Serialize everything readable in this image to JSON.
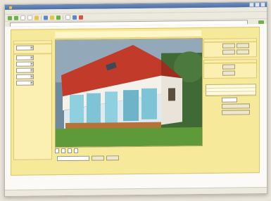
{
  "browser": {
    "title": "",
    "menu": [
      "",
      "",
      "",
      "",
      "",
      ""
    ],
    "address": ""
  },
  "app": {
    "header": "",
    "left": {
      "sections": [
        "",
        ""
      ],
      "fields": [
        {
          "label": "",
          "value": ""
        },
        {
          "label": "",
          "value": ""
        },
        {
          "label": "",
          "value": ""
        },
        {
          "label": "",
          "value": ""
        },
        {
          "label": "",
          "value": ""
        },
        {
          "label": "",
          "value": ""
        }
      ]
    },
    "right": {
      "section1": "",
      "rows1": [
        {
          "label": "",
          "b1": "",
          "b2": ""
        },
        {
          "label": "",
          "b1": "",
          "b2": ""
        }
      ],
      "section2": "",
      "rows2": [
        {
          "label": "",
          "b1": ""
        },
        {
          "label": "",
          "b1": ""
        }
      ],
      "big_heading": "",
      "table_rows": [
        "",
        "",
        ""
      ],
      "row_select": {
        "label": "",
        "value": ""
      },
      "buttons": [
        "",
        ""
      ]
    },
    "caption_chips": [
      "",
      "",
      "",
      ""
    ],
    "bottom": {
      "label": "",
      "field": "",
      "btn1": "",
      "btn2": ""
    },
    "footer": ""
  },
  "colors": {
    "accent": "#f6e99a",
    "section": "#e9d373",
    "roof": "#c23a2a",
    "wall": "#f4f1ea",
    "frame": "#8fd0e0",
    "lawn": "#5e9a3a"
  }
}
